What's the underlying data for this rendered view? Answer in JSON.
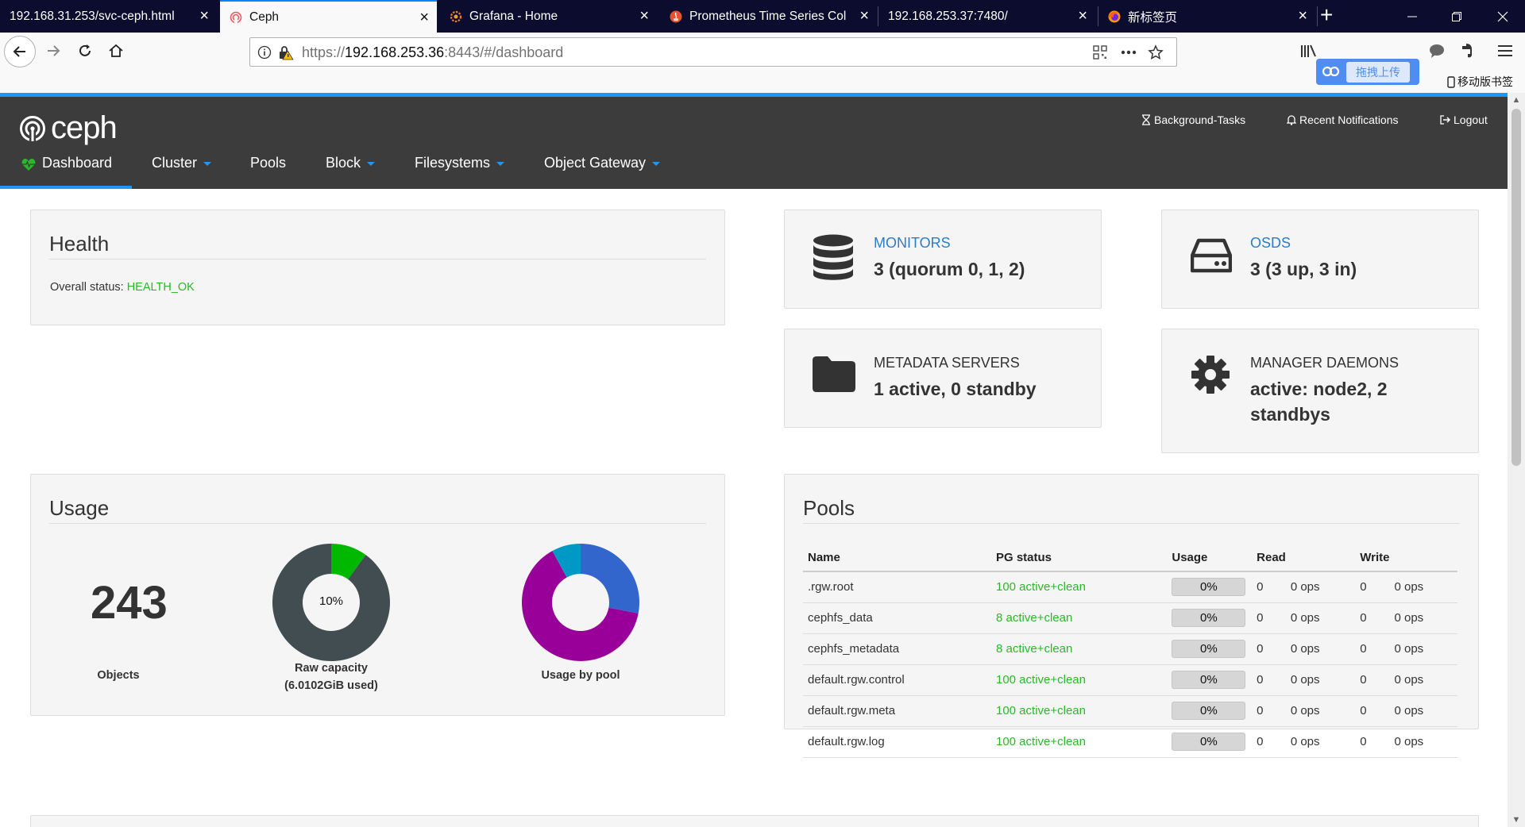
{
  "browser": {
    "tabs": [
      {
        "title": "192.168.31.253/svc-ceph.html",
        "icon": "none"
      },
      {
        "title": "Ceph",
        "icon": "ceph-favicon",
        "active": true
      },
      {
        "title": "Grafana - Home",
        "icon": "grafana-favicon"
      },
      {
        "title": "Prometheus Time Series Col",
        "icon": "prometheus-favicon"
      },
      {
        "title": "192.168.253.37:7480/",
        "icon": "none"
      },
      {
        "title": "新标签页",
        "icon": "firefox-favicon"
      }
    ],
    "tab_close": "×",
    "new_tab": "+",
    "url_prefix": "https://",
    "url_host": "192.168.253.36",
    "url_rest": ":8443/#/dashboard",
    "upload_label": "拖拽上传",
    "mobile_bookmarks": "移动版书签"
  },
  "ceph": {
    "logo_text": "ceph",
    "top_links": {
      "background_tasks": "Background-Tasks",
      "notifications": "Recent Notifications",
      "logout": "Logout"
    },
    "nav": {
      "dashboard": "Dashboard",
      "cluster": "Cluster",
      "pools": "Pools",
      "block": "Block",
      "filesystems": "Filesystems",
      "object_gateway": "Object Gateway"
    },
    "health": {
      "title": "Health",
      "status_label": "Overall status:",
      "status_value": "HEALTH_OK"
    },
    "monitors": {
      "label": "MONITORS",
      "value": "3 (quorum 0, 1, 2)"
    },
    "osds": {
      "label": "OSDS",
      "value": "3 (3 up, 3 in)"
    },
    "metadata": {
      "label": "METADATA SERVERS",
      "value": "1 active, 0 standby"
    },
    "managers": {
      "label": "MANAGER DAEMONS",
      "value_line1": "active: node2, 2",
      "value_line2": "standbys"
    },
    "usage": {
      "title": "Usage",
      "objects_count": "243",
      "objects_label": "Objects",
      "raw_percent": "10%",
      "raw_label_line1": "Raw capacity",
      "raw_label_line2": "(6.0102GiB used)",
      "pool_label": "Usage by pool"
    },
    "pools": {
      "title": "Pools",
      "headers": [
        "Name",
        "PG status",
        "Usage",
        "Read",
        "",
        "Write",
        ""
      ],
      "rows": [
        {
          "name": ".rgw.root",
          "pg": "100 active+clean",
          "usage": "0%",
          "read": "0",
          "read_ops": "0 ops",
          "write": "0",
          "write_ops": "0 ops"
        },
        {
          "name": "cephfs_data",
          "pg": "8 active+clean",
          "usage": "0%",
          "read": "0",
          "read_ops": "0 ops",
          "write": "0",
          "write_ops": "0 ops"
        },
        {
          "name": "cephfs_metadata",
          "pg": "8 active+clean",
          "usage": "0%",
          "read": "0",
          "read_ops": "0 ops",
          "write": "0",
          "write_ops": "0 ops"
        },
        {
          "name": "default.rgw.control",
          "pg": "100 active+clean",
          "usage": "0%",
          "read": "0",
          "read_ops": "0 ops",
          "write": "0",
          "write_ops": "0 ops"
        },
        {
          "name": "default.rgw.meta",
          "pg": "100 active+clean",
          "usage": "0%",
          "read": "0",
          "read_ops": "0 ops",
          "write": "0",
          "write_ops": "0 ops"
        },
        {
          "name": "default.rgw.log",
          "pg": "100 active+clean",
          "usage": "0%",
          "read": "0",
          "read_ops": "0 ops",
          "write": "0",
          "write_ops": "0 ops"
        }
      ]
    }
  },
  "charts": {
    "raw_capacity": {
      "used_fraction": 0.1,
      "used_color": "#00b800",
      "free_color": "#424d52"
    },
    "usage_by_pool": {
      "slices": [
        {
          "fraction": 0.28,
          "color": "#3366cc"
        },
        {
          "fraction": 0.64,
          "color": "#990099"
        },
        {
          "fraction": 0.08,
          "color": "#0099c6"
        }
      ]
    }
  },
  "colors": {
    "accent": "#2196f3",
    "header_bg": "#3c3c3c",
    "health_ok": "#2ab72a",
    "link": "#2c7cc9"
  }
}
